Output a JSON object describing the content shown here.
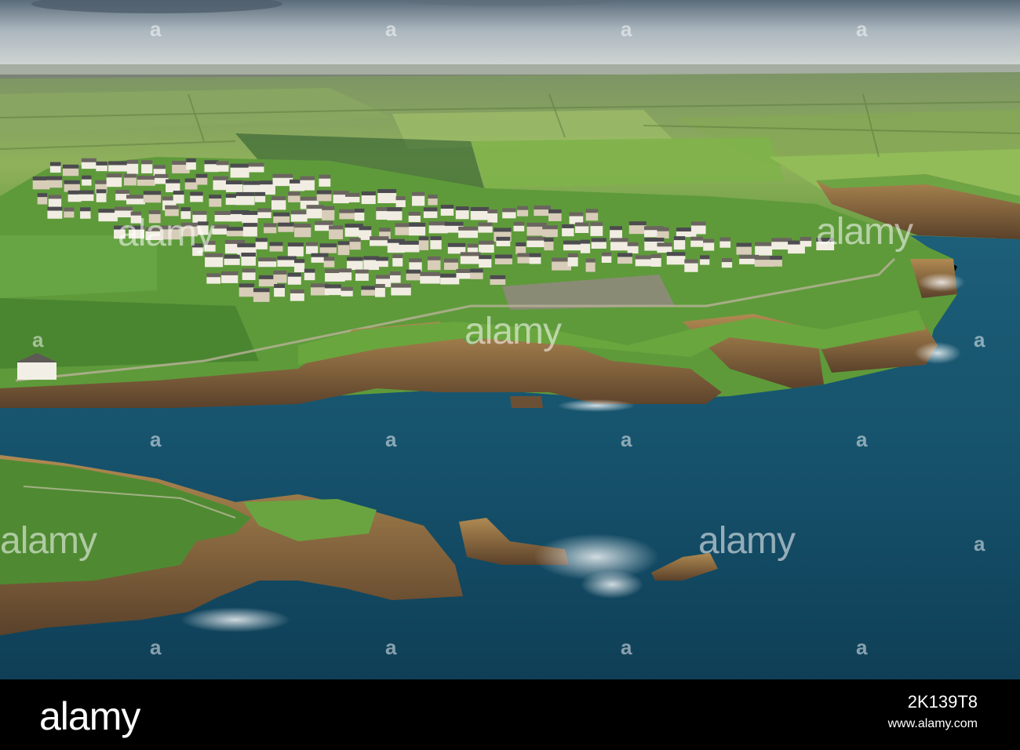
{
  "watermark": {
    "text": "alamy",
    "dot": "a"
  },
  "footer": {
    "logo": "alamy",
    "image_id": "2K139T8",
    "site": "www.alamy.com"
  },
  "colors": {
    "sea": "#15506a",
    "grass": "#5f9a3a",
    "cliff": "#7a5c3a",
    "sky": "#cfd6da"
  }
}
